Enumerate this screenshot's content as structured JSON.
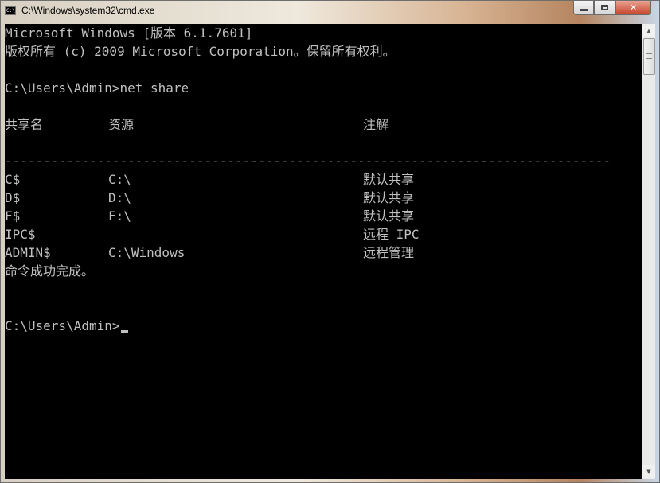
{
  "window": {
    "title": "C:\\Windows\\system32\\cmd.exe",
    "icon_label": "C:\\",
    "controls": {
      "minimize": "minimize",
      "maximize": "maximize",
      "close": "✕"
    }
  },
  "console": {
    "header_line1": "Microsoft Windows [版本 6.1.7601]",
    "header_line2": "版权所有 (c) 2009 Microsoft Corporation。保留所有权利。",
    "command_line": "C:\\Users\\Admin>net share",
    "table_headers": {
      "share_name": "共享名",
      "resource": "资源",
      "remark": "注解"
    },
    "separator": "-------------------------------------------------------------------------------",
    "shares": [
      {
        "name": "C$",
        "resource": "C:\\",
        "remark": "默认共享"
      },
      {
        "name": "D$",
        "resource": "D:\\",
        "remark": "默认共享"
      },
      {
        "name": "F$",
        "resource": "F:\\",
        "remark": "默认共享"
      },
      {
        "name": "IPC$",
        "resource": "",
        "remark": "远程 IPC"
      },
      {
        "name": "ADMIN$",
        "resource": "C:\\Windows",
        "remark": "远程管理"
      }
    ],
    "success_message": "命令成功完成。",
    "prompt": "C:\\Users\\Admin>"
  },
  "colors": {
    "console_bg": "#000000",
    "console_fg": "#c0c0c0",
    "close_button": "#c8452c"
  }
}
